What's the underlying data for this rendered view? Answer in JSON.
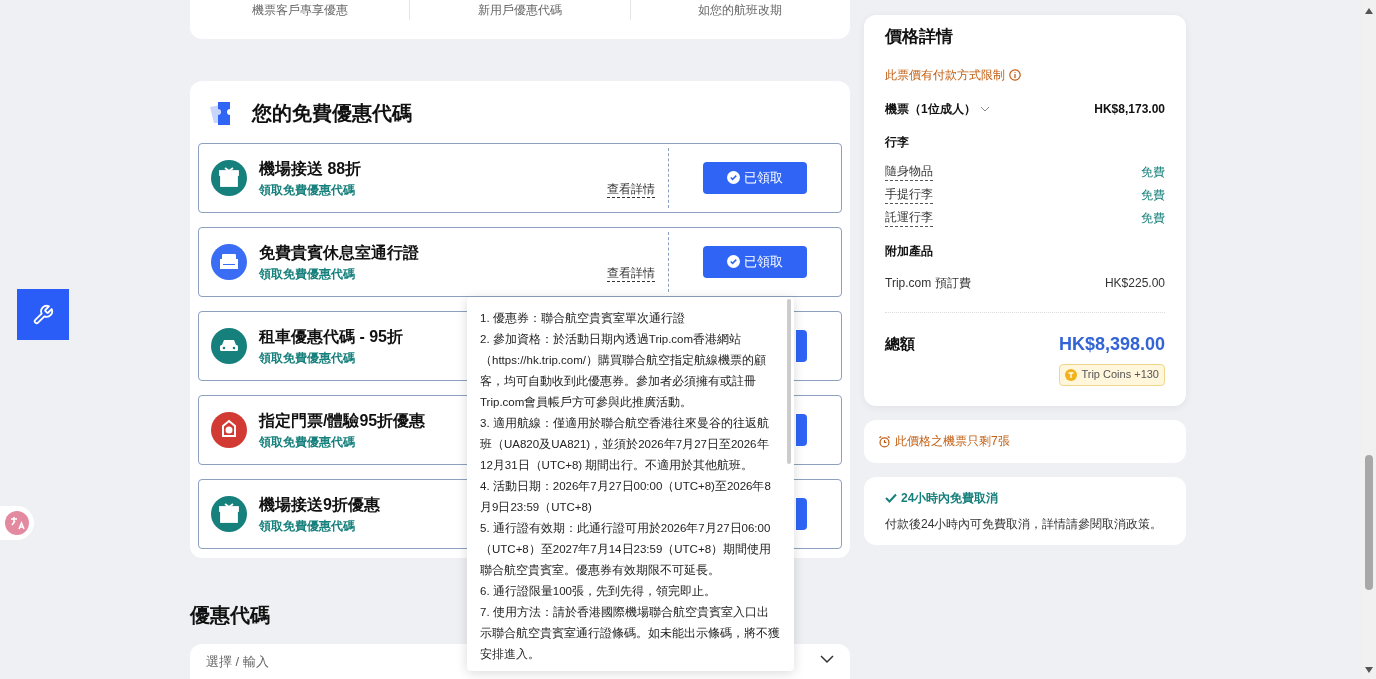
{
  "top_benefits": [
    "機票客戶專享優惠",
    "新用戶優惠代碼",
    "如您的航班改期"
  ],
  "free_codes": {
    "title": "您的免費優惠代碼",
    "coupons": [
      {
        "kind": "gift",
        "color": "#16807c",
        "title": "機場接送 88折",
        "subtitle": "領取免費優惠代碼",
        "details_link": "查看詳情",
        "button_label": "已領取"
      },
      {
        "kind": "sofa",
        "color": "#3a6cf4",
        "title": "免費貴賓休息室通行證",
        "subtitle": "領取免費優惠代碼",
        "details_link": "查看詳情",
        "button_label": "已領取"
      },
      {
        "kind": "car",
        "color": "#16807c",
        "title": "租車優惠代碼 - 95折",
        "subtitle": "領取免費優惠代碼"
      },
      {
        "kind": "ticket",
        "color": "#d23b33",
        "title": "指定門票/體驗95折優惠",
        "subtitle": "領取免費優惠代碼"
      },
      {
        "kind": "gift",
        "color": "#16807c",
        "title": "機場接送9折優惠",
        "subtitle": "領取免費優惠代碼"
      }
    ]
  },
  "tooltip": [
    "1. 優惠券：聯合航空貴賓室單次通行證",
    "2. 參加資格：於活動日期內透過Trip.com香港網站（https://hk.trip.com/）購買聯合航空指定航線機票的顧客，均可自動收到此優惠券。參加者必須擁有或註冊Trip.com會員帳戶方可參與此推廣活動。",
    "3. 適用航線：僅適用於聯合航空香港往來曼谷的往返航班（UA820及UA821)，並須於2026年7月27日至2026年12月31日（UTC+8) 期間出行。不適用於其他航班。",
    "4. 活動日期：2026年7月27日00:00（UTC+8)至2026年8月9日23:59（UTC+8)",
    "5. 通行證有效期：此通行證可用於2026年7月27日06:00（UTC+8）至2027年7月14日23:59（UTC+8）期間使用聯合航空貴賓室。優惠券有效期限不可延長。",
    "6. 通行證限量100張，先到先得，領完即止。",
    "7. 使用方法：請於香港國際機場聯合航空貴賓室入口出示聯合航空貴賓室通行證條碼。如未能出示條碼，將不獲安排進入。"
  ],
  "promo_code": {
    "title": "優惠代碼",
    "placeholder": "選擇 / 輸入"
  },
  "price": {
    "title": "價格詳情",
    "restriction": "此票價有付款方式限制",
    "ticket_label": "機票（1位成人）",
    "ticket_price": "HK$8,173.00",
    "baggage_title": "行李",
    "baggage": [
      {
        "label": "隨身物品",
        "value": "免費"
      },
      {
        "label": "手提行李",
        "value": "免費"
      },
      {
        "label": "託運行李",
        "value": "免費"
      }
    ],
    "addons_title": "附加產品",
    "addons": [
      {
        "label": "Trip.com 預訂費",
        "value": "HK$225.00"
      }
    ],
    "total_label": "總額",
    "total": "HK$8,398.00",
    "coins": "Trip Coins +130"
  },
  "seats_left": "此價格之機票只剩7張",
  "cancel": {
    "title": "24小時內免費取消",
    "text": "付款後24小時內可免費取消，詳情請參閱取消政策。"
  }
}
